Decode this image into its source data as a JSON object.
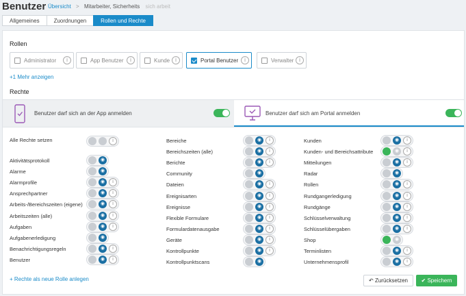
{
  "header": {
    "title": "Benutzer",
    "breadcrumb_link": "Übersicht",
    "breadcrumb_sep": ">",
    "breadcrumb_current": "Mitarbeiter, Sicherheits",
    "breadcrumb_muted": "sich arbeit"
  },
  "tabs": [
    {
      "label": "Allgemeines",
      "active": false
    },
    {
      "label": "Zuordnungen",
      "active": false
    },
    {
      "label": "Rollen und Rechte",
      "active": true
    }
  ],
  "roles_section": {
    "title": "Rollen",
    "items": [
      {
        "label": "Administrator",
        "checked": false
      },
      {
        "label": "App Benutzer",
        "checked": false
      },
      {
        "label": "Kunde",
        "checked": false
      },
      {
        "label": "Portal Benutzer",
        "checked": true
      },
      {
        "label": "Verwalter",
        "checked": false
      }
    ],
    "more_link": "+1 Mehr anzeigen"
  },
  "rights_section": {
    "title": "Rechte",
    "app_login": {
      "label": "Benutzer darf sich an der App anmelden",
      "enabled": true
    },
    "portal_login": {
      "label": "Benutzer darf sich am Portal anmelden",
      "enabled": true
    }
  },
  "permissions": {
    "all_label": "Alle Rechte setzen",
    "col1": [
      {
        "label": "Aktivitätsprotokoll",
        "mode": "view",
        "has_info": false
      },
      {
        "label": "Alarme",
        "mode": "view",
        "has_info": false
      },
      {
        "label": "Alarmprofile",
        "mode": "view",
        "has_info": true
      },
      {
        "label": "Ansprechpartner",
        "mode": "view",
        "has_info": true
      },
      {
        "label": "Arbeits-/Bereichszeiten (eigene)",
        "mode": "view",
        "has_info": true
      },
      {
        "label": "Arbeitszeiten (alle)",
        "mode": "view",
        "has_info": true
      },
      {
        "label": "Aufgaben",
        "mode": "view",
        "has_info": true
      },
      {
        "label": "Aufgabenerledigung",
        "mode": "view",
        "has_info": false
      },
      {
        "label": "Benachrichtigungsregeln",
        "mode": "view",
        "has_info": true
      },
      {
        "label": "Benutzer",
        "mode": "view",
        "has_info": true
      }
    ],
    "col2": [
      {
        "label": "Bereiche",
        "mode": "view",
        "has_info": true
      },
      {
        "label": "Bereichszeiten (alle)",
        "mode": "view",
        "has_info": true
      },
      {
        "label": "Berichte",
        "mode": "view",
        "has_info": true
      },
      {
        "label": "Community",
        "mode": "view",
        "has_info": false
      },
      {
        "label": "Dateien",
        "mode": "view",
        "has_info": true
      },
      {
        "label": "Ereignisarten",
        "mode": "view",
        "has_info": true
      },
      {
        "label": "Ereignisse",
        "mode": "view",
        "has_info": true
      },
      {
        "label": "Flexible Formulare",
        "mode": "view",
        "has_info": true
      },
      {
        "label": "Formulardatenausgabe",
        "mode": "view",
        "has_info": true
      },
      {
        "label": "Geräte",
        "mode": "view",
        "has_info": true
      },
      {
        "label": "Kontrollpunkte",
        "mode": "view",
        "has_info": true
      },
      {
        "label": "Kontrollpunktscans",
        "mode": "view",
        "has_info": false
      }
    ],
    "col3": [
      {
        "label": "Kunden",
        "mode": "view",
        "has_info": true
      },
      {
        "label": "Kunden- und Bereichsattribute",
        "mode": "green",
        "has_info": true
      },
      {
        "label": "Mitteilungen",
        "mode": "view",
        "has_info": true
      },
      {
        "label": "Radar",
        "mode": "view",
        "has_info": false
      },
      {
        "label": "Rollen",
        "mode": "view",
        "has_info": true
      },
      {
        "label": "Rundgangerledigung",
        "mode": "view",
        "has_info": true
      },
      {
        "label": "Rundgänge",
        "mode": "view",
        "has_info": true
      },
      {
        "label": "Schlüsselverwaltung",
        "mode": "view",
        "has_info": true
      },
      {
        "label": "Schlüsselübergaben",
        "mode": "view",
        "has_info": true
      },
      {
        "label": "Shop",
        "mode": "green",
        "has_info": false
      },
      {
        "label": "Terminlisten",
        "mode": "view",
        "has_info": true
      },
      {
        "label": "Unternehmensprofil",
        "mode": "view",
        "has_info": true
      }
    ]
  },
  "footer": {
    "new_role_link": "+ Rechte als neue Rolle anlegen",
    "reset_label": "Zurücksetzen",
    "save_label": "Speichern"
  },
  "colors": {
    "accent": "#1a8bc9",
    "success": "#3bb55a",
    "view": "#1a6fa3"
  }
}
